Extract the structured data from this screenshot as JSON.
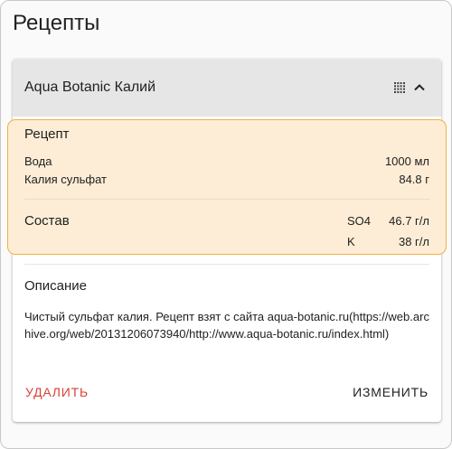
{
  "page": {
    "title": "Рецепты"
  },
  "card": {
    "title": "Aqua Botanic Калий",
    "icons": {
      "grid": "grid-dots-icon",
      "collapse": "chevron-up-icon"
    },
    "recipe": {
      "heading": "Рецепт",
      "rows": [
        {
          "label": "Вода",
          "value": "1000 мл"
        },
        {
          "label": "Калия сульфат",
          "value": "84.8 г"
        }
      ]
    },
    "composition": {
      "heading": "Состав",
      "items": [
        {
          "element": "SO4",
          "value": "46.7 г/л"
        },
        {
          "element": "K",
          "value": "38 г/л"
        }
      ]
    },
    "description": {
      "heading": "Описание",
      "text": "Чистый сульфат калия. Рецепт взят с сайта aqua-botanic.ru(https://web.archive.org/web/20131206073940/http://www.aqua-botanic.ru/index.html)"
    },
    "actions": {
      "delete_label": "УДАЛИТЬ",
      "edit_label": "ИЗМЕНИТЬ"
    }
  },
  "colors": {
    "accent_highlight": "#fdedd6",
    "highlight_border": "#f0b04a",
    "delete": "#d94236"
  }
}
